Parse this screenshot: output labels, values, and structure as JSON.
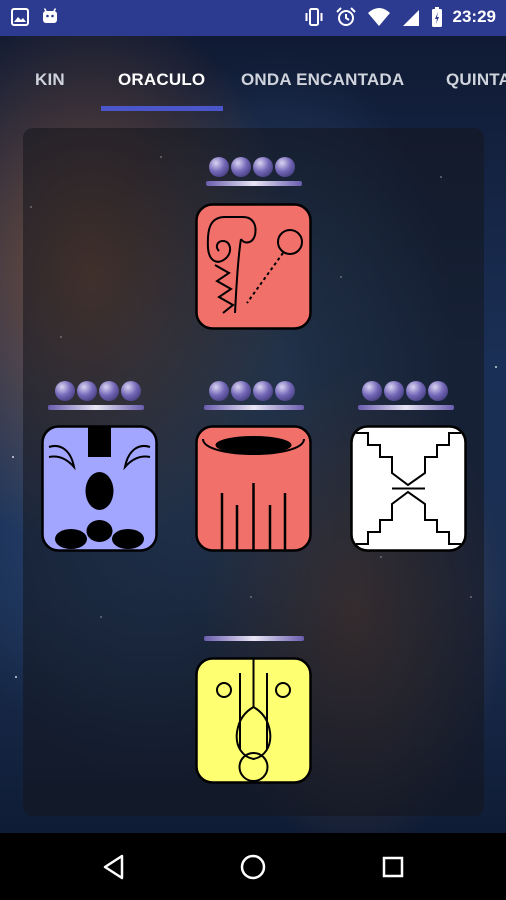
{
  "status_bar": {
    "time": "23:29",
    "left_icons": [
      "image-icon",
      "android-icon"
    ],
    "right_icons": [
      "vibrate-icon",
      "alarm-icon",
      "wifi-icon",
      "signal-icon",
      "battery-icon"
    ]
  },
  "tabs": [
    {
      "label": "KIN"
    },
    {
      "label": "ORACULO"
    },
    {
      "label": "ONDA ENCANTADA"
    },
    {
      "label": "QUINTA"
    }
  ],
  "active_tab": "ORACULO",
  "oracle": {
    "guide": {
      "position": "top",
      "tone_dots": 4,
      "color": "#f2706a"
    },
    "analog": {
      "position": "left",
      "tone_dots": 4,
      "color": "#a3a6ff"
    },
    "destiny": {
      "position": "center",
      "tone_dots": 4,
      "color": "#f2706a"
    },
    "antipode": {
      "position": "right",
      "tone_dots": 4,
      "color": "#ffffff"
    },
    "occult": {
      "position": "bottom",
      "tone_dots": 0,
      "color": "#ffff72"
    }
  },
  "navigation": {
    "icons": [
      "back-icon",
      "home-icon",
      "recents-icon"
    ]
  }
}
